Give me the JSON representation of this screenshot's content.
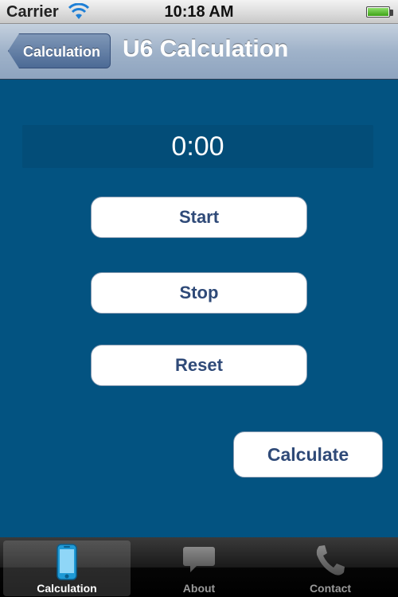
{
  "status_bar": {
    "carrier": "Carrier",
    "time": "10:18 AM",
    "battery_level": 1.0
  },
  "nav": {
    "back_label": "Calculation",
    "title": "U6 Calculation"
  },
  "timer": {
    "value": "0:00"
  },
  "buttons": {
    "start": "Start",
    "stop": "Stop",
    "reset": "Reset",
    "calculate": "Calculate"
  },
  "tabs": [
    {
      "label": "Calculation",
      "icon": "phone-device-icon",
      "selected": true
    },
    {
      "label": "About",
      "icon": "speech-bubble-icon",
      "selected": false
    },
    {
      "label": "Contact",
      "icon": "telephone-handset-icon",
      "selected": false
    }
  ],
  "colors": {
    "background": "#035381",
    "button_text": "#2f4a78",
    "selected_tab_icon": "#37b6f0"
  }
}
